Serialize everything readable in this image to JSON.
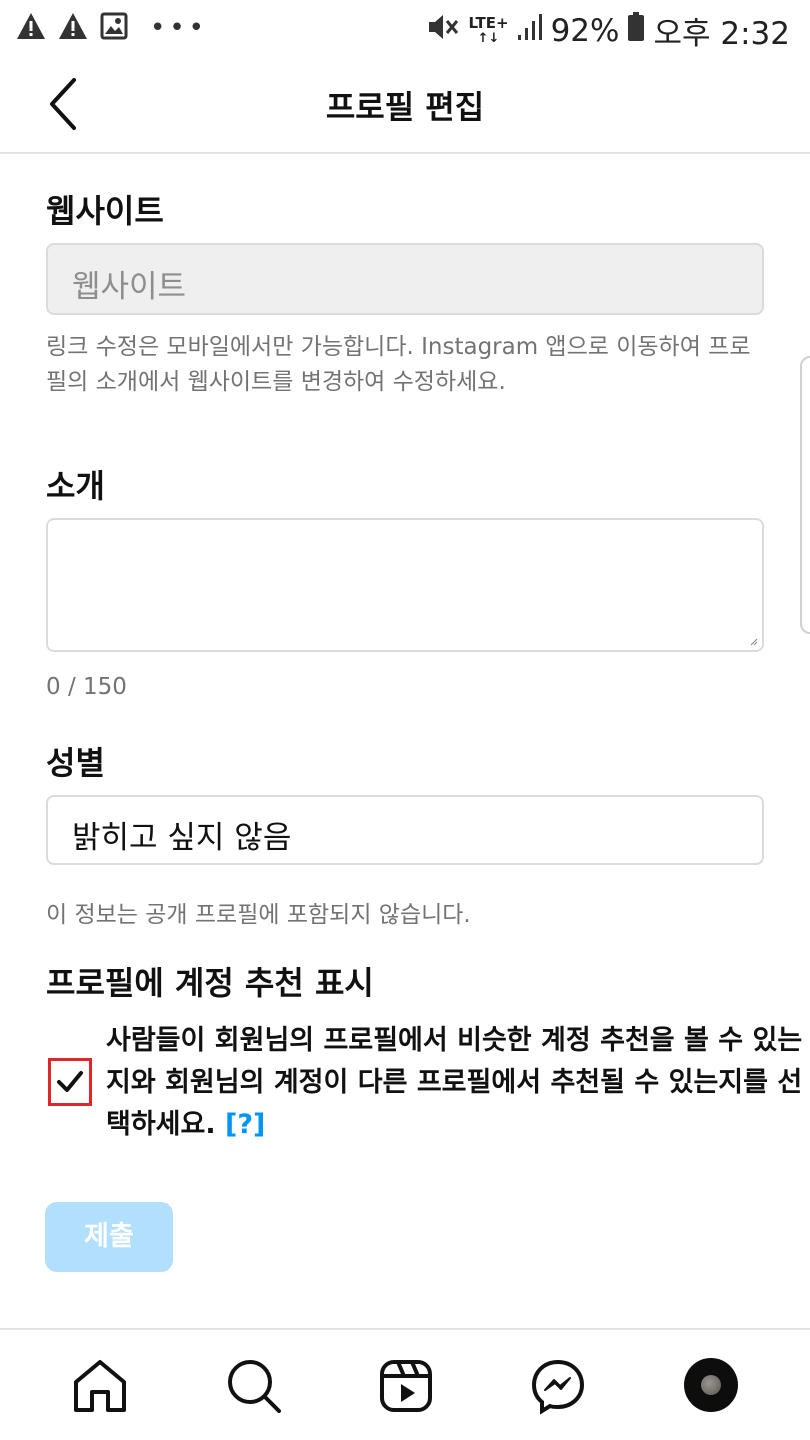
{
  "status_bar": {
    "icons_left": [
      "warning-icon",
      "warning-icon",
      "image-icon",
      "more-dots-icon"
    ],
    "network": "LTE+",
    "battery": "92%",
    "time": "오후 2:32"
  },
  "header": {
    "title": "프로필 편집"
  },
  "website": {
    "label": "웹사이트",
    "placeholder": "웹사이트",
    "hint": "링크 수정은 모바일에서만 가능합니다. Instagram 앱으로 이동하여 프로필의 소개에서 웹사이트를 변경하여 수정하세요."
  },
  "bio": {
    "label": "소개",
    "value": "",
    "counter": "0 / 150"
  },
  "gender": {
    "label": "성별",
    "value": "밝히고 싶지 않음",
    "hint": "이 정보는 공개 프로필에 포함되지 않습니다."
  },
  "suggestions": {
    "label": "프로필에 계정 추천 표시",
    "description": "사람들이 회원님의 프로필에서 비슷한 계정 추천을 볼 수 있는지와 회원님의 계정이 다른 프로필에서 추천될 수 있는지를 선택하세요.",
    "help_link": "[?]",
    "checked": true
  },
  "submit": {
    "label": "제출"
  },
  "bottom_nav": {
    "items": [
      "home-icon",
      "search-icon",
      "reels-icon",
      "messenger-icon",
      "profile-avatar"
    ]
  },
  "colors": {
    "accent": "#0095f6",
    "submit_disabled": "#b2dffc",
    "highlight_box": "#e2252b",
    "hint_text": "#737373"
  }
}
